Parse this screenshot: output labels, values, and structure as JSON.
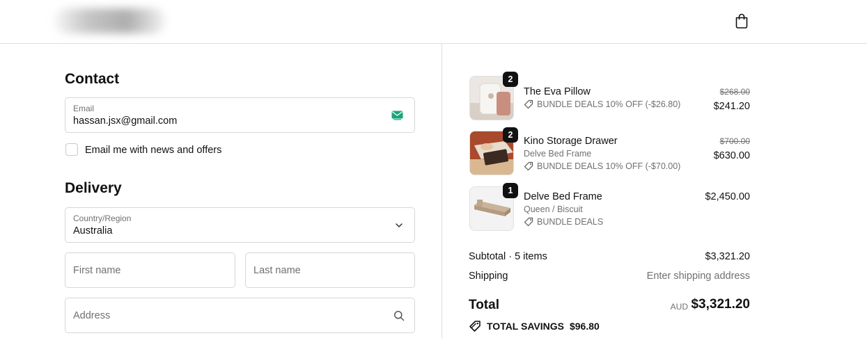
{
  "header": {
    "logo_alt": "Store logo (blurred)",
    "cart_icon": "shopping-bag-icon"
  },
  "contact": {
    "heading": "Contact",
    "email_label": "Email",
    "email_value": "hassan.jsx@gmail.com",
    "news_label": "Email me with news and offers",
    "news_checked": false
  },
  "delivery": {
    "heading": "Delivery",
    "country_label": "Country/Region",
    "country_value": "Australia",
    "first_name_placeholder": "First name",
    "last_name_placeholder": "Last name",
    "address_placeholder": "Address"
  },
  "cart": {
    "items": [
      {
        "qty": "2",
        "name": "The Eva Pillow",
        "variant": "",
        "deal": "BUNDLE DEALS 10% OFF (-$26.80)",
        "compare_price": "$268.00",
        "price": "$241.20"
      },
      {
        "qty": "2",
        "name": "Kino Storage Drawer",
        "variant": "Delve Bed Frame",
        "deal": "BUNDLE DEALS 10% OFF (-$70.00)",
        "compare_price": "$700.00",
        "price": "$630.00"
      },
      {
        "qty": "1",
        "name": "Delve Bed Frame",
        "variant": "Queen / Biscuit",
        "deal": "BUNDLE DEALS",
        "compare_price": "",
        "price": "$2,450.00"
      }
    ]
  },
  "summary": {
    "subtotal_label": "Subtotal · 5 items",
    "subtotal_value": "$3,321.20",
    "shipping_label": "Shipping",
    "shipping_value": "Enter shipping address",
    "total_label": "Total",
    "currency": "AUD",
    "total_value": "$3,321.20",
    "savings_label": "TOTAL SAVINGS",
    "savings_value": "$96.80"
  },
  "colors": {
    "border": "#d6d6d6",
    "muted": "#707070",
    "badge": "#111111",
    "email_icon": "#1aa37a"
  }
}
